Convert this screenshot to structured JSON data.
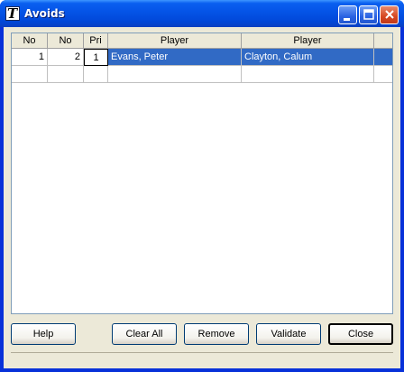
{
  "window": {
    "title": "Avoids",
    "app_icon_glyph": "T",
    "controls": {
      "minimize": "minimize-icon",
      "maximize": "maximize-icon",
      "close": "close-icon"
    }
  },
  "grid": {
    "columns": [
      "No",
      "No",
      "Pri",
      "Player",
      "Player"
    ],
    "rows": [
      {
        "no1": "1",
        "no2": "2",
        "pri": "1",
        "player1": "Evans, Peter",
        "player2": "Clayton, Calum",
        "selected": true
      }
    ]
  },
  "buttons": {
    "help": "Help",
    "clear_all": "Clear All",
    "remove": "Remove",
    "validate": "Validate",
    "close": "Close"
  },
  "colors": {
    "selection": "#316ac5",
    "title_bar": "#0453e6",
    "face": "#ece9d8"
  }
}
